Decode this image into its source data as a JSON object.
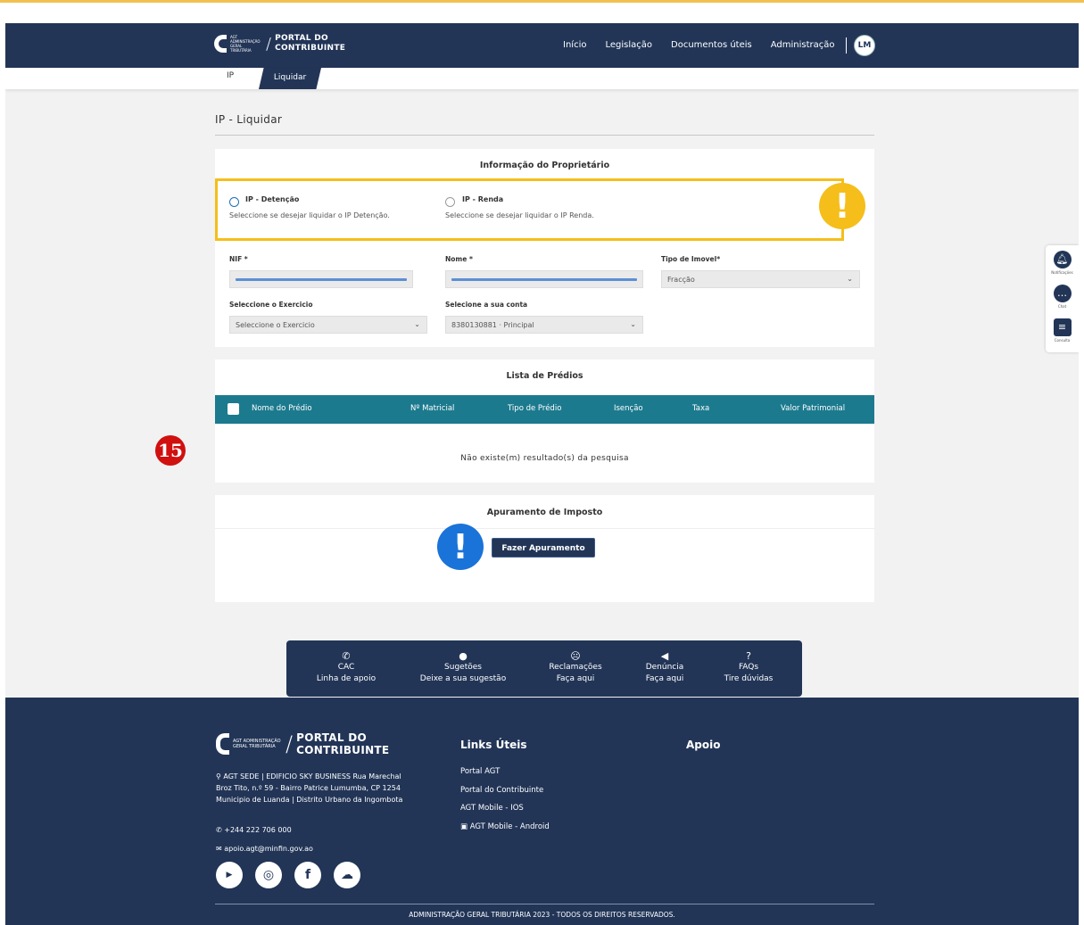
{
  "header": {
    "logo_small": "AGT ADMINISTRAÇÃO GERAL TRIBUTÁRIA",
    "logo_title_1": "PORTAL DO",
    "logo_title_2": "CONTRIBUINTE",
    "nav": [
      "Início",
      "Legislação",
      "Documentos úteis",
      "Administração"
    ],
    "user_initials": "LM"
  },
  "tabs": {
    "ip": "IP",
    "liquidar": "Liquidar"
  },
  "page_title": "IP - Liquidar",
  "owner": {
    "title": "Informação do Proprietário",
    "option1": {
      "title": "IP - Detenção",
      "desc": "Seleccione se desejar liquidar o IP Detenção.",
      "selected": true
    },
    "option2": {
      "title": "IP - Renda",
      "desc": "Seleccione se desejar liquidar o IP Renda.",
      "selected": false
    },
    "nif_label": "NIF *",
    "nome_label": "Nome *",
    "tipo_label": "Tipo de Imovel*",
    "tipo_value": "Fracção",
    "exercicio_label": "Seleccione o Exercicio",
    "exercicio_value": "Seleccione o Exercicio",
    "conta_label": "Selecione a sua conta",
    "conta_value": "8380130881 · Principal"
  },
  "list": {
    "title": "Lista de Prédios",
    "columns": [
      "Nome do Prédio",
      "Nº Matricial",
      "Tipo de Prédio",
      "Isenção",
      "Taxa",
      "Valor Patrimonial"
    ],
    "empty": "Não existe(m) resultado(s) da pesquisa"
  },
  "calc": {
    "title": "Apuramento de Imposto",
    "button": "Fazer Apuramento"
  },
  "badge": "15",
  "side_widget": {
    "notif": "Notificações",
    "chat": "Chat",
    "consulta": "Consulta"
  },
  "support": [
    {
      "icon": "phone-icon",
      "glyph": "✆",
      "line1": "CAC",
      "line2": "Linha de apoio"
    },
    {
      "icon": "chat-bubble-icon",
      "glyph": "●",
      "line1": "Sugetões",
      "line2": "Deixe a sua sugestão"
    },
    {
      "icon": "sad-face-icon",
      "glyph": "☹",
      "line1": "Reclamações",
      "line2": "Faça aqui"
    },
    {
      "icon": "megaphone-icon",
      "glyph": "◀",
      "line1": "Denúncia",
      "line2": "Faça aqui"
    },
    {
      "icon": "question-chat-icon",
      "glyph": "?",
      "line1": "FAQs",
      "line2": "Tire dúvidas"
    }
  ],
  "footer": {
    "logo_small": "AGT ADMINISTRAÇÃO GERAL TRIBUTÁRIA",
    "logo_title_1": "PORTAL DO",
    "logo_title_2": "CONTRIBUINTE",
    "address": "AGT SEDE | EDIFICIO SKY BUSINESS Rua Marechal Broz Tito, n.º 59 - Bairro Patrice Lumumba, CP 1254 Municipio de Luanda | Distrito Urbano da Ingombota",
    "phone": "+244 222 706 000",
    "email": "apoio.agt@minfin.gov.ao",
    "links_title": "Links Úteis",
    "links": [
      "Portal AGT",
      "Portal do Contribuinte",
      "AGT Mobile - IOS",
      "AGT Mobile - Android"
    ],
    "apoio_title": "Apoio",
    "copyright": "ADMINISTRAÇÃO GERAL TRIBUTÁRIA 2023 - TODOS OS DIREITOS RESERVADOS."
  },
  "colors": {
    "navy": "#223557",
    "teal": "#1c7a8e",
    "warning": "#f5be1a",
    "info": "#1a73d8",
    "badge": "#d11010"
  }
}
